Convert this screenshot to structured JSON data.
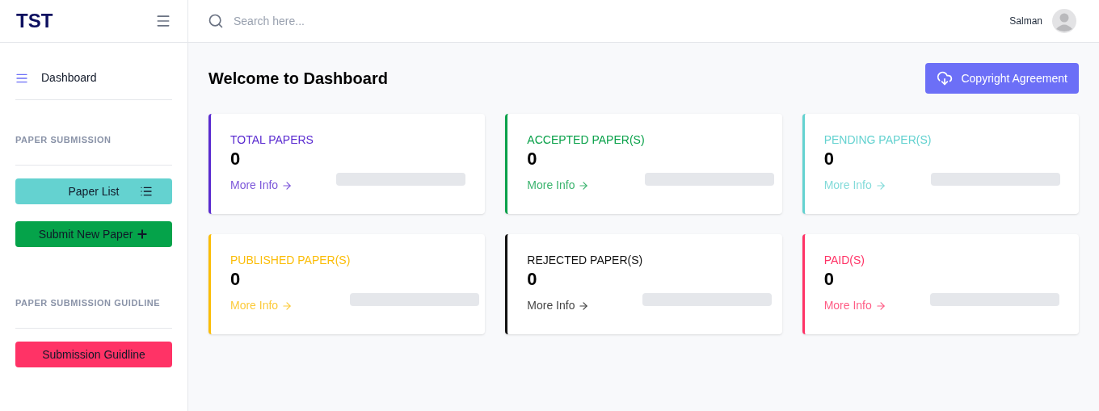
{
  "brand": "TST",
  "search": {
    "placeholder": "Search here..."
  },
  "user": {
    "name": "Salman"
  },
  "sidebar": {
    "items": [
      {
        "kind": "link",
        "label": "Dashboard"
      },
      {
        "kind": "heading",
        "label": "PAPER SUBMISSION"
      },
      {
        "kind": "list-button",
        "label": "Paper List",
        "color": "#64d2d0"
      },
      {
        "kind": "add-button",
        "label": "Submit New Paper",
        "color": "#05a34a"
      },
      {
        "kind": "heading",
        "label": "PAPER SUBMISSION GUIDLINE"
      },
      {
        "kind": "button",
        "label": "Submission Guidline",
        "color": "#ff3366"
      }
    ]
  },
  "page_title": "Welcome to Dashboard",
  "action_button": {
    "label": "Copyright Agreement"
  },
  "cards": [
    {
      "title": "TOTAL PAPERS",
      "value": "0",
      "link": "More Info",
      "color": "#5a2bd0"
    },
    {
      "title": "ACCEPTED PAPER(S)",
      "value": "0",
      "link": "More Info",
      "color": "#0aa14a"
    },
    {
      "title": "PENDING PAPER(S)",
      "value": "0",
      "link": "More Info",
      "color": "#64d2d0"
    },
    {
      "title": "PUBLISHED PAPER(S)",
      "value": "0",
      "link": "More Info",
      "color": "#fbbd08"
    },
    {
      "title": "REJECTED PAPER(S)",
      "value": "0",
      "link": "More Info",
      "color": "#111111"
    },
    {
      "title": "PAID(S)",
      "value": "0",
      "link": "More Info",
      "color": "#ff3366"
    }
  ]
}
